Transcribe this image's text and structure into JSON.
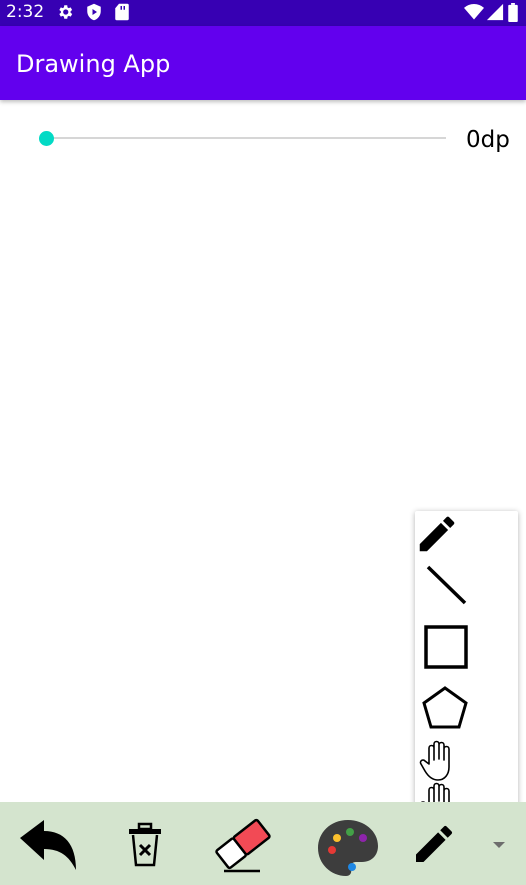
{
  "status_bar": {
    "time": "2:32",
    "icons_left": [
      "gear-icon",
      "shield-icon",
      "sd-card-icon"
    ],
    "icons_right": [
      "wifi-icon",
      "signal-icon",
      "battery-icon"
    ]
  },
  "app_bar": {
    "title": "Drawing App"
  },
  "stroke_width": {
    "value": 0,
    "label": "0dp"
  },
  "shape_menu": {
    "items": [
      {
        "icon": "pencil-icon"
      },
      {
        "icon": "line-icon"
      },
      {
        "icon": "rectangle-icon"
      },
      {
        "icon": "pentagon-icon"
      },
      {
        "icon": "hand-icon"
      },
      {
        "icon": "hand-icon"
      }
    ]
  },
  "toolbar": {
    "items": [
      {
        "icon": "undo-icon"
      },
      {
        "icon": "trash-icon"
      },
      {
        "icon": "eraser-icon"
      },
      {
        "icon": "palette-icon"
      },
      {
        "icon": "pencil-icon"
      },
      {
        "icon": "dropdown-arrow-icon"
      }
    ],
    "colors": {
      "background": "#d4e4ce",
      "eraser": "#f24a55",
      "palette": "#3d3d3d"
    }
  },
  "colors": {
    "status_bar": "#3700b3",
    "app_bar": "#6200ee",
    "accent": "#03dac5"
  }
}
